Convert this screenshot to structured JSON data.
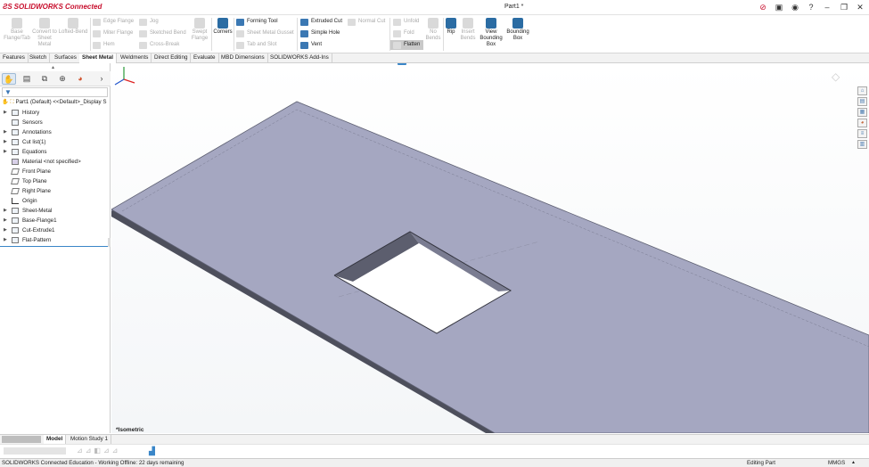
{
  "titlebar": {
    "app_logo": "SOLIDWORKS Connected",
    "document_title": "Part1 *"
  },
  "command_manager": {
    "buttons_large": [
      {
        "label": "Base Flange/Tab",
        "enabled": false
      },
      {
        "label": "Convert to Sheet Metal",
        "enabled": false
      },
      {
        "label": "Lofted-Bend",
        "enabled": false
      }
    ],
    "buttons_col1": [
      {
        "label": "Edge Flange",
        "enabled": false
      },
      {
        "label": "Miter Flange",
        "enabled": false
      },
      {
        "label": "Hem",
        "enabled": false
      }
    ],
    "buttons_col2": [
      {
        "label": "Jog",
        "enabled": false
      },
      {
        "label": "Sketched Bend",
        "enabled": false
      },
      {
        "label": "Cross-Break",
        "enabled": false
      }
    ],
    "swept_flange": "Swept Flange",
    "corners": "Corners",
    "buttons_col3": [
      {
        "label": "Forming Tool",
        "enabled": true
      },
      {
        "label": "Sheet Metal Gusset",
        "enabled": false
      },
      {
        "label": "Tab and Slot",
        "enabled": false
      }
    ],
    "buttons_col4": [
      {
        "label": "Extruded Cut",
        "enabled": true
      },
      {
        "label": "Simple Hole",
        "enabled": true
      },
      {
        "label": "Vent",
        "enabled": true
      }
    ],
    "normal_cut": "Normal Cut",
    "buttons_col5": [
      {
        "label": "Unfold",
        "enabled": false
      },
      {
        "label": "Fold",
        "enabled": false
      },
      {
        "label": "Flatten",
        "enabled": true
      }
    ],
    "no_bends": "No Bends",
    "rip": "Rip",
    "insert_bends": "Insert Bends",
    "view_bounding_box": "View Bounding Box",
    "bounding_box": "Bounding Box"
  },
  "tabs": [
    "Features",
    "Sketch",
    "Surfaces",
    "Sheet Metal",
    "Weldments",
    "Direct Editing",
    "Evaluate",
    "MBD Dimensions",
    "SOLIDWORKS Add-Ins"
  ],
  "active_tab": "Sheet Metal",
  "feature_tree": {
    "root": "Part1 (Default) <<Default>_Display S",
    "items": [
      {
        "label": "History",
        "expandable": true
      },
      {
        "label": "Sensors",
        "expandable": false
      },
      {
        "label": "Annotations",
        "expandable": true
      },
      {
        "label": "Cut list(1)",
        "expandable": true
      },
      {
        "label": "Equations",
        "expandable": true
      },
      {
        "label": "Material <not specified>",
        "expandable": false
      },
      {
        "label": "Front Plane",
        "expandable": false
      },
      {
        "label": "Top Plane",
        "expandable": false
      },
      {
        "label": "Right Plane",
        "expandable": false
      },
      {
        "label": "Origin",
        "expandable": false
      },
      {
        "label": "Sheet-Metal",
        "expandable": true
      },
      {
        "label": "Base-Flange1",
        "expandable": true
      },
      {
        "label": "Cut-Extrude1",
        "expandable": true
      },
      {
        "label": "Flat-Pattern",
        "expandable": true
      }
    ]
  },
  "viewport": {
    "view_orientation": "*Isometric"
  },
  "bottom_tabs": [
    "Model",
    "Motion Study 1"
  ],
  "active_bottom_tab": "Model",
  "status": {
    "left": "SOLIDWORKS Connected Education - Working Offline: 22 days remaining",
    "mode": "Editing Part",
    "units": "MMGS"
  },
  "colors": {
    "plate_top": "#a5a7c1",
    "plate_edge": "#5a5c6a",
    "accent": "#3a86c8"
  }
}
